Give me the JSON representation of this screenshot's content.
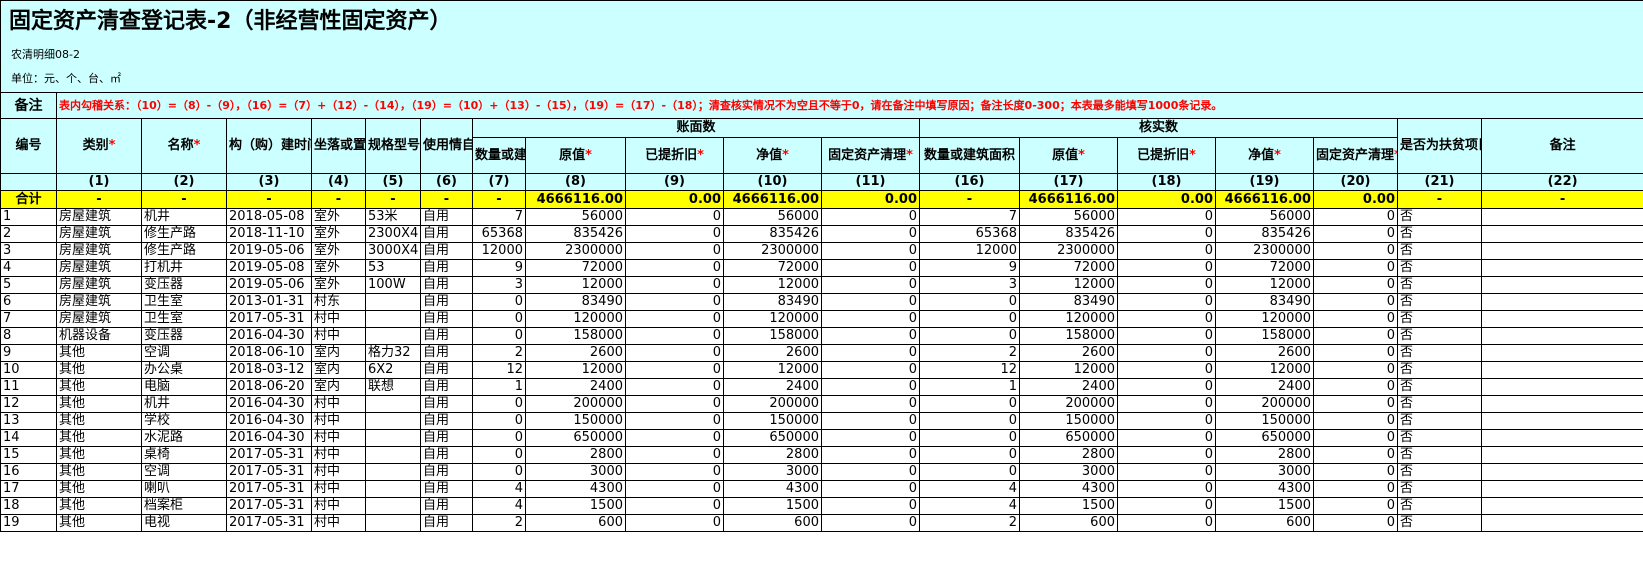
{
  "sheet": {
    "title": "固定资产清查登记表-2（非经营性固定资产）",
    "subtitle": "农清明细08-2",
    "unit": "单位：元、个、台、㎡",
    "note_label": "备注",
    "note_text": "表内勾稽关系：（10）=（8）-（9），（16）=（7）+（12）-（14），（19）=（10）+（13）-（15），（19）=（17）-（18）；清查核实情况不为空且不等于0，请在备注中填写原因；备注长度0-300；本表最多能填写1000条记录。",
    "colors": {
      "header_bg": "#ccffff",
      "total_bg": "#ffff00",
      "required_star": "#ff0000"
    }
  },
  "groups": {
    "book": "账面数",
    "verified": "核实数"
  },
  "headers": {
    "id": "编号",
    "category": "类别",
    "name": "名称",
    "build_time": "构（购）建时间",
    "location": "坐落或置放位置",
    "spec": "规格型号",
    "usage": "使用情自用/闲置/",
    "book_qty": "数量或建筑面",
    "book_orig": "原值",
    "book_depr": "已提折旧",
    "book_net": "净值",
    "book_clear": "固定资产清理",
    "ver_qty": "数量或建筑面积",
    "ver_orig": "原值",
    "ver_depr": "已提折旧",
    "ver_net": "净值",
    "ver_clear": "固定资产清理",
    "poverty": "是否为扶贫项目形成资产",
    "remark": "备注"
  },
  "star": "*",
  "index_row": [
    "(1)",
    "(2)",
    "(3)",
    "(4)",
    "(5)",
    "(6)",
    "(7)",
    "(8)",
    "(9)",
    "(10)",
    "(11)",
    "(16)",
    "(17)",
    "(18)",
    "(19)",
    "(20)",
    "(21)",
    "(22)"
  ],
  "total_row": [
    "合计",
    "-",
    "-",
    "-",
    "-",
    "-",
    "-",
    "-",
    "4666116.00",
    "0.00",
    "4666116.00",
    "0.00",
    "-",
    "4666116.00",
    "0.00",
    "4666116.00",
    "0.00",
    "-",
    "-"
  ],
  "rows": [
    [
      "1",
      "房屋建筑",
      "机井",
      "2018-05-08",
      "室外",
      "53米",
      "自用",
      "7",
      "56000",
      "0",
      "56000",
      "0",
      "7",
      "56000",
      "0",
      "56000",
      "0",
      "否",
      ""
    ],
    [
      "2",
      "房屋建筑",
      "修生产路",
      "2018-11-10",
      "室外",
      "2300X4",
      "自用",
      "65368",
      "835426",
      "0",
      "835426",
      "0",
      "65368",
      "835426",
      "0",
      "835426",
      "0",
      "否",
      ""
    ],
    [
      "3",
      "房屋建筑",
      "修生产路",
      "2019-05-06",
      "室外",
      "3000X4",
      "自用",
      "12000",
      "2300000",
      "0",
      "2300000",
      "0",
      "12000",
      "2300000",
      "0",
      "2300000",
      "0",
      "否",
      ""
    ],
    [
      "4",
      "房屋建筑",
      "打机井",
      "2019-05-08",
      "室外",
      "53",
      "自用",
      "9",
      "72000",
      "0",
      "72000",
      "0",
      "9",
      "72000",
      "0",
      "72000",
      "0",
      "否",
      ""
    ],
    [
      "5",
      "房屋建筑",
      "变压器",
      "2019-05-06",
      "室外",
      "100W",
      "自用",
      "3",
      "12000",
      "0",
      "12000",
      "0",
      "3",
      "12000",
      "0",
      "12000",
      "0",
      "否",
      ""
    ],
    [
      "6",
      "房屋建筑",
      "卫生室",
      "2013-01-31",
      "村东",
      "",
      "自用",
      "0",
      "83490",
      "0",
      "83490",
      "0",
      "0",
      "83490",
      "0",
      "83490",
      "0",
      "否",
      ""
    ],
    [
      "7",
      "房屋建筑",
      "卫生室",
      "2017-05-31",
      "村中",
      "",
      "自用",
      "0",
      "120000",
      "0",
      "120000",
      "0",
      "0",
      "120000",
      "0",
      "120000",
      "0",
      "否",
      ""
    ],
    [
      "8",
      "机器设备",
      "变压器",
      "2016-04-30",
      "村中",
      "",
      "自用",
      "0",
      "158000",
      "0",
      "158000",
      "0",
      "0",
      "158000",
      "0",
      "158000",
      "0",
      "否",
      ""
    ],
    [
      "9",
      "其他",
      "空调",
      "2018-06-10",
      "室内",
      "格力32",
      "自用",
      "2",
      "2600",
      "0",
      "2600",
      "0",
      "2",
      "2600",
      "0",
      "2600",
      "0",
      "否",
      ""
    ],
    [
      "10",
      "其他",
      "办公桌",
      "2018-03-12",
      "室内",
      "6X2",
      "自用",
      "12",
      "12000",
      "0",
      "12000",
      "0",
      "12",
      "12000",
      "0",
      "12000",
      "0",
      "否",
      ""
    ],
    [
      "11",
      "其他",
      "电脑",
      "2018-06-20",
      "室内",
      "联想",
      "自用",
      "1",
      "2400",
      "0",
      "2400",
      "0",
      "1",
      "2400",
      "0",
      "2400",
      "0",
      "否",
      ""
    ],
    [
      "12",
      "其他",
      "机井",
      "2016-04-30",
      "村中",
      "",
      "自用",
      "0",
      "200000",
      "0",
      "200000",
      "0",
      "0",
      "200000",
      "0",
      "200000",
      "0",
      "否",
      ""
    ],
    [
      "13",
      "其他",
      "学校",
      "2016-04-30",
      "村中",
      "",
      "自用",
      "0",
      "150000",
      "0",
      "150000",
      "0",
      "0",
      "150000",
      "0",
      "150000",
      "0",
      "否",
      ""
    ],
    [
      "14",
      "其他",
      "水泥路",
      "2016-04-30",
      "村中",
      "",
      "自用",
      "0",
      "650000",
      "0",
      "650000",
      "0",
      "0",
      "650000",
      "0",
      "650000",
      "0",
      "否",
      ""
    ],
    [
      "15",
      "其他",
      "桌椅",
      "2017-05-31",
      "村中",
      "",
      "自用",
      "0",
      "2800",
      "0",
      "2800",
      "0",
      "0",
      "2800",
      "0",
      "2800",
      "0",
      "否",
      ""
    ],
    [
      "16",
      "其他",
      "空调",
      "2017-05-31",
      "村中",
      "",
      "自用",
      "0",
      "3000",
      "0",
      "3000",
      "0",
      "0",
      "3000",
      "0",
      "3000",
      "0",
      "否",
      ""
    ],
    [
      "17",
      "其他",
      "喇叭",
      "2017-05-31",
      "村中",
      "",
      "自用",
      "4",
      "4300",
      "0",
      "4300",
      "0",
      "4",
      "4300",
      "0",
      "4300",
      "0",
      "否",
      ""
    ],
    [
      "18",
      "其他",
      "档案柜",
      "2017-05-31",
      "村中",
      "",
      "自用",
      "4",
      "1500",
      "0",
      "1500",
      "0",
      "4",
      "1500",
      "0",
      "1500",
      "0",
      "否",
      ""
    ],
    [
      "19",
      "其他",
      "电视",
      "2017-05-31",
      "村中",
      "",
      "自用",
      "2",
      "600",
      "0",
      "600",
      "0",
      "2",
      "600",
      "0",
      "600",
      "0",
      "否",
      ""
    ]
  ]
}
